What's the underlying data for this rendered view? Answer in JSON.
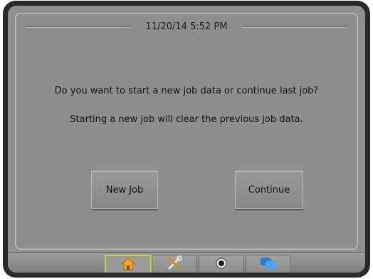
{
  "header": {
    "datetime": "11/20/14 5:52 PM"
  },
  "dialog": {
    "question": "Do you want to start a new job data or continue last job?",
    "warning": "Starting a new job will clear the previous job data."
  },
  "buttons": {
    "new_job": "New Job",
    "continue": "Continue"
  },
  "bottom_tabs": [
    {
      "icon": "home-icon",
      "active": true
    },
    {
      "icon": "tools-icon",
      "active": false
    },
    {
      "icon": "camera-icon",
      "active": false
    },
    {
      "icon": "chat-bubbles-icon",
      "active": false
    }
  ],
  "colors": {
    "active_tab_border": "#c6d43a",
    "home_icon": "#f5a623",
    "chat_icon": "#2a7fd4"
  }
}
